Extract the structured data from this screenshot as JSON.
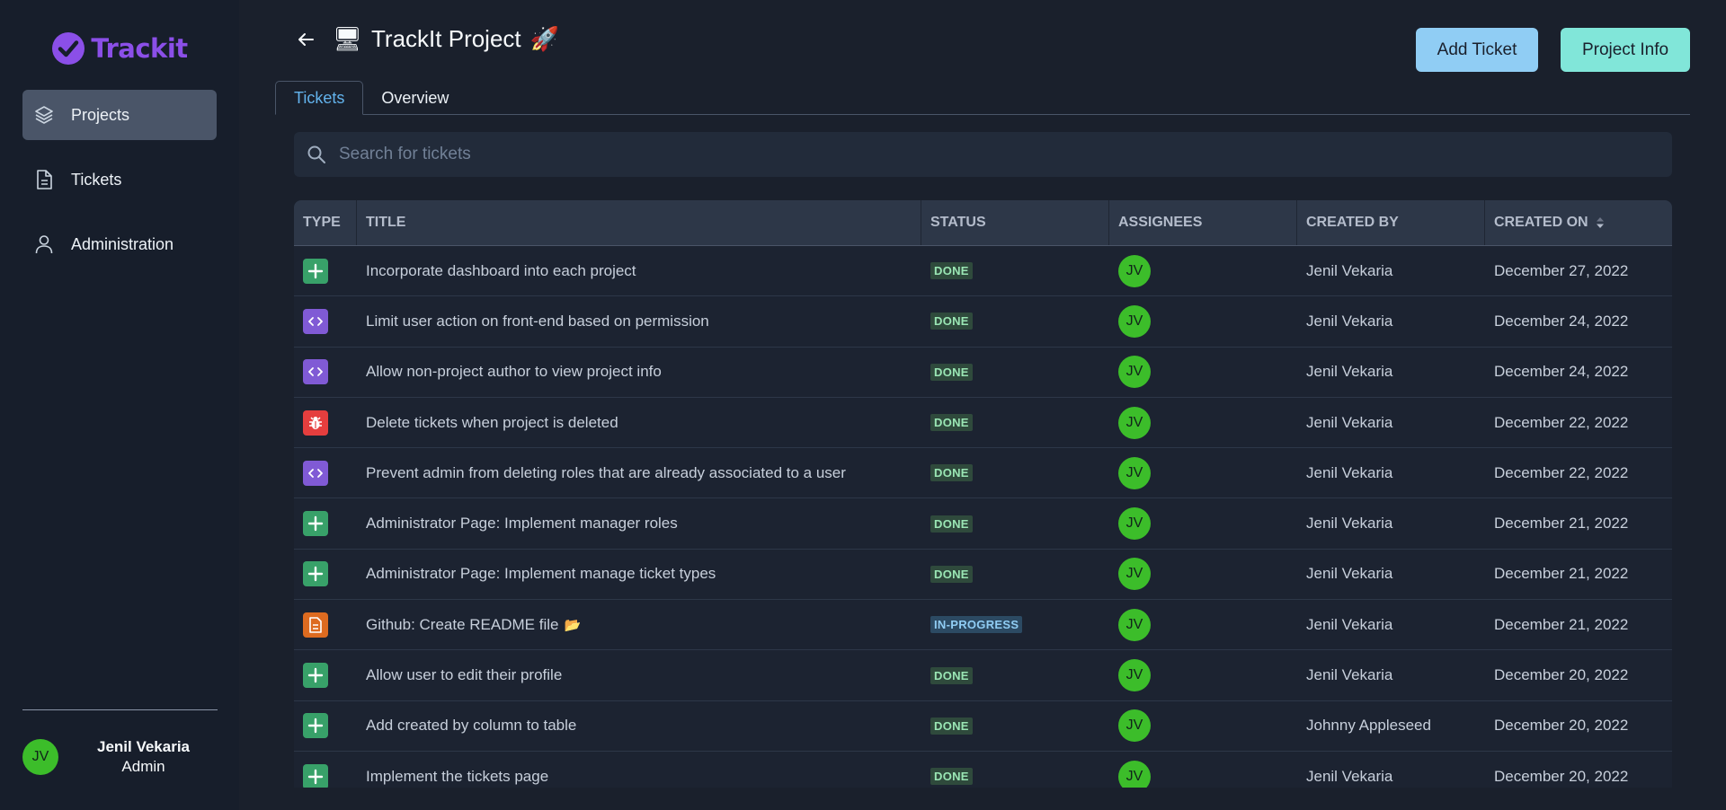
{
  "app": {
    "name": "Trackit",
    "brand_color": "#8b4fe8"
  },
  "sidebar": {
    "items": [
      {
        "label": "Projects",
        "icon": "layers-icon",
        "active": true
      },
      {
        "label": "Tickets",
        "icon": "document-icon",
        "active": false
      },
      {
        "label": "Administration",
        "icon": "user-icon",
        "active": false
      }
    ],
    "user": {
      "initials": "JV",
      "name": "Jenil Vekaria",
      "role": "Admin"
    }
  },
  "header": {
    "title_icon": "🖥",
    "title": "TrackIt Project",
    "title_emoji": "🚀",
    "add_ticket_label": "Add Ticket",
    "project_info_label": "Project Info"
  },
  "tabs": [
    {
      "label": "Tickets",
      "active": true
    },
    {
      "label": "Overview",
      "active": false
    }
  ],
  "search": {
    "placeholder": "Search for tickets",
    "value": ""
  },
  "table": {
    "columns": [
      "TYPE",
      "TITLE",
      "STATUS",
      "ASSIGNEES",
      "CREATED BY",
      "CREATED ON"
    ],
    "rows": [
      {
        "type": "feature",
        "title": "Incorporate dashboard into each project",
        "status": "DONE",
        "assignee": "JV",
        "created_by": "Jenil Vekaria",
        "created_on": "December 27, 2022"
      },
      {
        "type": "code",
        "title": "Limit user action on front-end based on permission",
        "status": "DONE",
        "assignee": "JV",
        "created_by": "Jenil Vekaria",
        "created_on": "December 24, 2022"
      },
      {
        "type": "code",
        "title": "Allow non-project author to view project info",
        "status": "DONE",
        "assignee": "JV",
        "created_by": "Jenil Vekaria",
        "created_on": "December 24, 2022"
      },
      {
        "type": "bug",
        "title": "Delete tickets when project is deleted",
        "status": "DONE",
        "assignee": "JV",
        "created_by": "Jenil Vekaria",
        "created_on": "December 22, 2022"
      },
      {
        "type": "code",
        "title": "Prevent admin from deleting roles that are already associated to a user",
        "status": "DONE",
        "assignee": "JV",
        "created_by": "Jenil Vekaria",
        "created_on": "December 22, 2022"
      },
      {
        "type": "feature",
        "title": "Administrator Page: Implement manager roles",
        "status": "DONE",
        "assignee": "JV",
        "created_by": "Jenil Vekaria",
        "created_on": "December 21, 2022"
      },
      {
        "type": "feature",
        "title": "Administrator Page: Implement manage ticket types",
        "status": "DONE",
        "assignee": "JV",
        "created_by": "Jenil Vekaria",
        "created_on": "December 21, 2022"
      },
      {
        "type": "doc",
        "title": "Github: Create README file",
        "title_emoji": "📂",
        "status": "IN-PROGRESS",
        "assignee": "JV",
        "created_by": "Jenil Vekaria",
        "created_on": "December 21, 2022"
      },
      {
        "type": "feature",
        "title": "Allow user to edit their profile",
        "status": "DONE",
        "assignee": "JV",
        "created_by": "Jenil Vekaria",
        "created_on": "December 20, 2022"
      },
      {
        "type": "feature",
        "title": "Add created by column to table",
        "status": "DONE",
        "assignee": "JV",
        "created_by": "Johnny Appleseed",
        "created_on": "December 20, 2022"
      },
      {
        "type": "feature",
        "title": "Implement the tickets page",
        "status": "DONE",
        "assignee": "JV",
        "created_by": "Jenil Vekaria",
        "created_on": "December 20, 2022"
      }
    ]
  },
  "colors": {
    "avatar": "#3cbd2a",
    "feature": "#38a169",
    "code": "#805ad5",
    "bug": "#e53e3e",
    "doc": "#dd6b20"
  }
}
